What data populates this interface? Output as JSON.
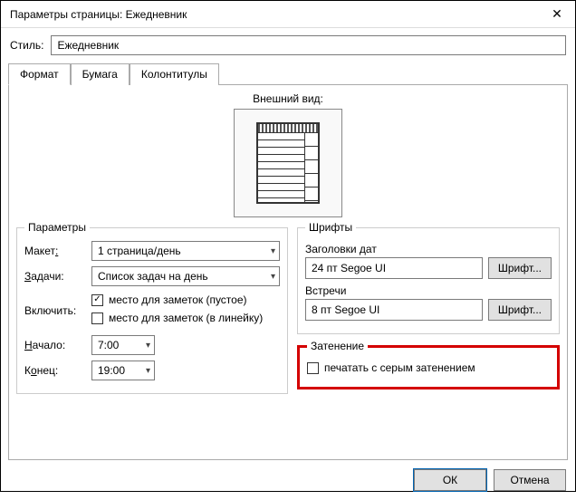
{
  "window": {
    "title": "Параметры страницы: Ежедневник"
  },
  "style_row": {
    "label": "Стиль:",
    "value": "Ежедневник"
  },
  "tabs": {
    "format": "Формат",
    "paper": "Бумага",
    "headers": "Колонтитулы"
  },
  "preview": {
    "label": "Внешний вид:"
  },
  "params": {
    "legend": "Параметры",
    "layout_label_pre": "Макет",
    "layout_label_ul": ":",
    "layout_value": "1 страница/день",
    "tasks_label_ul": "З",
    "tasks_label_post": "адачи:",
    "tasks_value": "Список задач на день",
    "include_label": "Включить:",
    "include_notes_blank": "место для заметок (пустое)",
    "include_notes_lined": "место для заметок (в линейку)",
    "start_label_ul": "Н",
    "start_label_post": "ачало:",
    "start_value": "7:00",
    "end_label_pre": "К",
    "end_label_ul": "о",
    "end_label_post": "нец:",
    "end_value": "19:00"
  },
  "fonts": {
    "legend": "Шрифты",
    "date_headers_label": "Заголовки дат",
    "date_headers_value": "24 пт Segoe UI",
    "appointments_label": "Встречи",
    "appointments_value": "8 пт Segoe UI",
    "font_button": "Шрифт..."
  },
  "shading": {
    "legend": "Затенение",
    "checkbox_label": "печатать с серым затенением"
  },
  "footer": {
    "ok": "ОК",
    "cancel": "Отмена"
  }
}
